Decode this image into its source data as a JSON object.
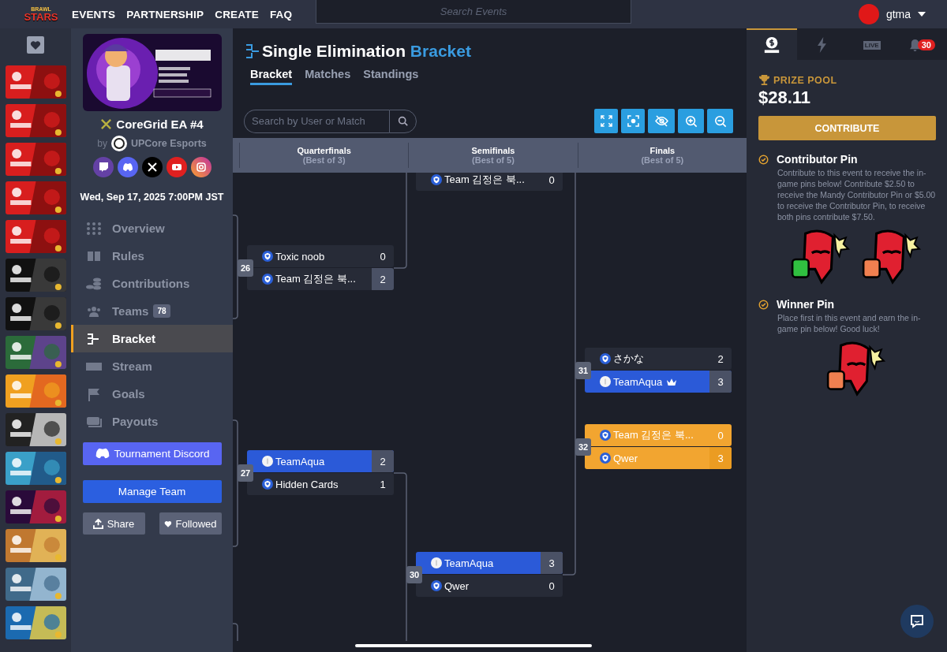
{
  "topbar": {
    "logo": {
      "line1": "BRAWL",
      "line2": "STARS"
    },
    "nav": [
      "EVENTS",
      "PARTNERSHIP",
      "CREATE",
      "FAQ"
    ],
    "search": {
      "placeholder": "Search Events"
    },
    "user": {
      "name": "gtma"
    }
  },
  "event": {
    "title": "CoreGrid EA #4",
    "by": "by",
    "organizer": "UPCore Esports",
    "date": "Wed, Sep 17, 2025 7:00PM JST",
    "nav": [
      {
        "label": "Overview",
        "selected": false
      },
      {
        "label": "Rules",
        "selected": false
      },
      {
        "label": "Contributions",
        "selected": false
      },
      {
        "label": "Teams",
        "badge": "78",
        "selected": false
      },
      {
        "label": "Bracket",
        "selected": true
      },
      {
        "label": "Stream",
        "selected": false
      },
      {
        "label": "Goals",
        "selected": false
      },
      {
        "label": "Payouts",
        "selected": false
      }
    ],
    "discord_button": "Tournament Discord",
    "manage_button": "Manage Team",
    "share_button": "Share",
    "follow_button": "Followed"
  },
  "main": {
    "title": "Single Elimination",
    "title_accent": "Bracket",
    "tabs": [
      {
        "label": "Bracket",
        "selected": true
      },
      {
        "label": "Matches",
        "selected": false
      },
      {
        "label": "Standings",
        "selected": false
      }
    ],
    "search": {
      "placeholder": "Search by User or Match"
    },
    "rounds": [
      {
        "name": "Quarterfinals",
        "format": "(Best of 3)"
      },
      {
        "name": "Semifinals",
        "format": "(Best of 5)"
      },
      {
        "name": "Finals",
        "format": "(Best of 5)"
      }
    ],
    "matches": [
      {
        "highlighted": false,
        "rows": [
          {
            "team": "Team 김정은 북...",
            "score": "0",
            "winner": false,
            "mine": false,
            "crown": false
          }
        ]
      },
      {
        "number": "26",
        "highlighted": false,
        "rows": [
          {
            "team": "Toxic noob",
            "score": "0",
            "winner": false,
            "mine": false,
            "crown": false
          },
          {
            "team": "Team 김정은 북...",
            "score": "2",
            "winner": true,
            "mine": false,
            "crown": false
          }
        ]
      },
      {
        "number": "27",
        "highlighted": false,
        "rows": [
          {
            "team": "TeamAqua",
            "score": "2",
            "winner": true,
            "mine": true,
            "crown": false
          },
          {
            "team": "Hidden Cards",
            "score": "1",
            "winner": false,
            "mine": false,
            "crown": false
          }
        ]
      },
      {
        "number": "30",
        "highlighted": false,
        "rows": [
          {
            "team": "TeamAqua",
            "score": "3",
            "winner": true,
            "mine": true,
            "crown": false
          },
          {
            "team": "Qwer",
            "score": "0",
            "winner": false,
            "mine": false,
            "crown": false
          }
        ]
      },
      {
        "number": "31",
        "highlighted": false,
        "rows": [
          {
            "team": "さかな",
            "score": "2",
            "winner": false,
            "mine": false,
            "crown": false
          },
          {
            "team": "TeamAqua",
            "score": "3",
            "winner": true,
            "mine": true,
            "crown": true
          }
        ]
      },
      {
        "number": "32",
        "highlighted": true,
        "rows": [
          {
            "team": "Team 김정은 북...",
            "score": "0",
            "winner": false,
            "mine": false,
            "crown": false
          },
          {
            "team": "Qwer",
            "score": "3",
            "winner": true,
            "mine": false,
            "crown": false
          }
        ]
      }
    ]
  },
  "panel": {
    "tabs": [
      {
        "selected": true
      },
      {
        "selected": false
      },
      {
        "label": "LIVE",
        "selected": false
      },
      {
        "badge": "30",
        "selected": false
      }
    ],
    "prize_label": "PRIZE POOL",
    "prize": "$28.11",
    "contribute": "CONTRIBUTE",
    "sections": [
      {
        "title": "Contributor Pin",
        "text": "Contribute to this event to receive the in-game pins below! Contribute $2.50 to receive the Mandy Contributor Pin or $5.00 to receive the Contributor Pin, to receive both pins contribute $7.50.",
        "pins": [
          {
            "kind": "pin"
          },
          {
            "kind": "pin"
          }
        ]
      },
      {
        "title": "Winner Pin",
        "text": "Place first in this event and earn the in-game pin below! Good luck!",
        "pins": [
          {
            "kind": "pin"
          }
        ]
      }
    ]
  }
}
